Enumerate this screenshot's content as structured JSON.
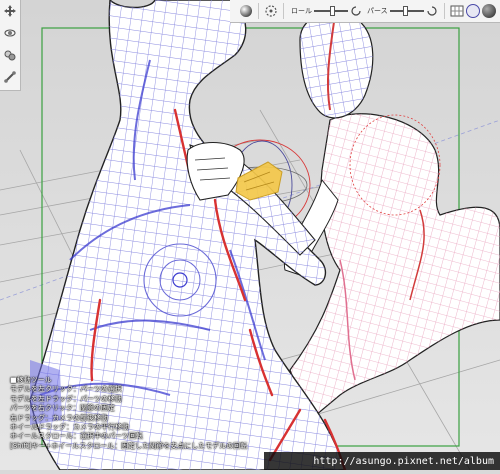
{
  "toolbar": {
    "roll_label": "ロール",
    "roll_value": 0.55,
    "perspective_label": "パース",
    "perspective_value": 0.45,
    "icons": [
      "light-sphere-icon",
      "camera-rotate-icon",
      "roll-icon",
      "perspective-icon",
      "grid-icon",
      "render-mode-icon",
      "shaded-sphere-icon"
    ]
  },
  "left_tools": [
    "move-tool-icon",
    "camera-rotate-tool-icon",
    "body-shape-tool-icon",
    "bone-edit-tool-icon"
  ],
  "help": {
    "title": "■移動ツール",
    "lines": [
      "モデルを左クリック：パーツの選択",
      "モデルを左ドラッグ：パーツの移動",
      "パーツを右クリック：関節の固定",
      "右ドラッグ：カメラの前後移動",
      "ホイールドラッグ：カメラの平行移動",
      "ホイールスクロール：選択中のパーツ回転",
      "[Shift]キー+ホイールスクロール：固定した関節を支点にしたモデルの回転"
    ]
  },
  "watermark": "http://asungo.pixnet.net/album",
  "colors": {
    "mesh_line": "#7b7bd6",
    "mesh_bold": "#3c3cd0",
    "center_line": "#e03c3c",
    "frame": "#3aa040",
    "selection": "#f4c84a"
  }
}
